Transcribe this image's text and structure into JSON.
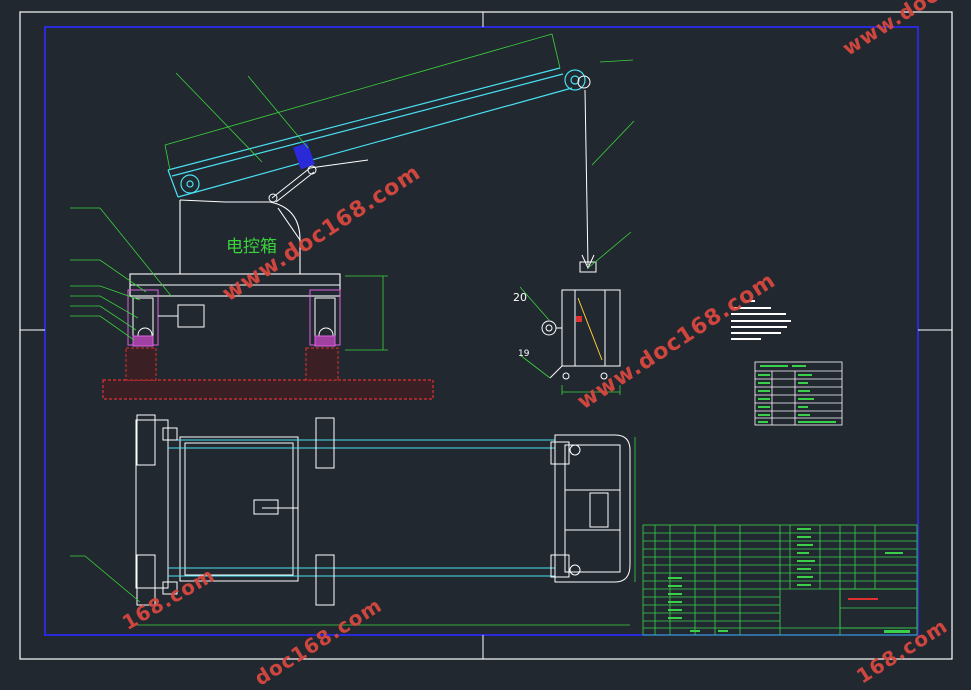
{
  "drawing": {
    "control_box_label": "电控箱",
    "label_20": "20",
    "label_19": "19"
  },
  "watermark": {
    "text": "www.doc168.com",
    "short_1": "www.doc",
    "short_2": "168.com",
    "short_3": "doc168.com"
  },
  "colors": {
    "background": "#212830",
    "frame": "#ffffff",
    "border_blue": "#2a2ad8",
    "outline_cyan": "#49e0f0",
    "leader_green": "#3bd23b",
    "table_green": "#3ad14a",
    "foundation_red": "#e03030",
    "watermark_red": "#d8483f"
  }
}
